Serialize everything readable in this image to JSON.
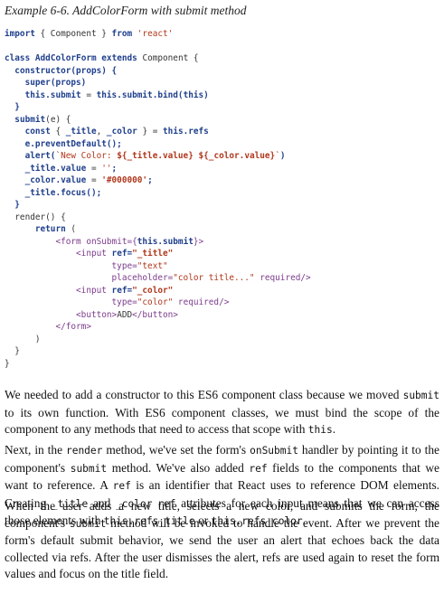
{
  "caption": "Example 6-6. AddColorForm with submit method",
  "code_lines": [
    "import { Component } from 'react'",
    "",
    "class AddColorForm extends Component {",
    "  constructor(props) {",
    "    super(props)",
    "    this.submit = this.submit.bind(this)",
    "  }",
    "  submit(e) {",
    "    const { _title, _color } = this.refs",
    "    e.preventDefault();",
    "    alert(`New Color: ${_title.value} ${_color.value}`)",
    "    _title.value = '';",
    "    _color.value = '#000000';",
    "    _title.focus();",
    "  }",
    "  render() {",
    "      return (",
    "          <form onSubmit={this.submit}>",
    "              <input ref=\"_title\"",
    "                     type=\"text\"",
    "                     placeholder=\"color title...\" required/>",
    "              <input ref=\"_color\"",
    "                     type=\"color\" required/>",
    "              <button>ADD</button>",
    "          </form>",
    "      )",
    "  }",
    "}"
  ],
  "paragraphs": {
    "p1": {
      "a": "We needed to add a constructor to this ES6 component class because we moved ",
      "m1": "submit",
      "b": " to its own function. With ES6 component classes, we must bind the scope of the component to any methods that need to access that scope with ",
      "m2": "this",
      "c": "."
    },
    "p2": {
      "a": "Next, in the ",
      "m1": "render",
      "b": " method, we've set the form's ",
      "m2": "onSubmit",
      "c": " handler by pointing it to the component's ",
      "m3": "submit",
      "d": " method. We've also added ",
      "m4": "ref",
      "e": " fields to the components that we want to reference. A ",
      "m5": "ref",
      "f": " is an identifier that React uses to reference DOM elements. Creating ",
      "m6": "_title",
      "g": " and ",
      "m7": "_color",
      "h": " ",
      "m8": "ref",
      "i": " attributes for each input means that we can access those elements with ",
      "m9": "this.refs_title",
      "j": " or ",
      "m10": "this.refs_color",
      "k": "."
    },
    "p3": {
      "a": "When the user adds a new title, selects a new color, and submits the form, the component's ",
      "m1": "submit",
      "b": " method will be invoked to handle the event. After we prevent the form's default submit behavior, we send the user an alert that echoes back the data collected via refs. After the user dismisses the alert, refs are used again to reset the form values and focus on the title field."
    }
  }
}
